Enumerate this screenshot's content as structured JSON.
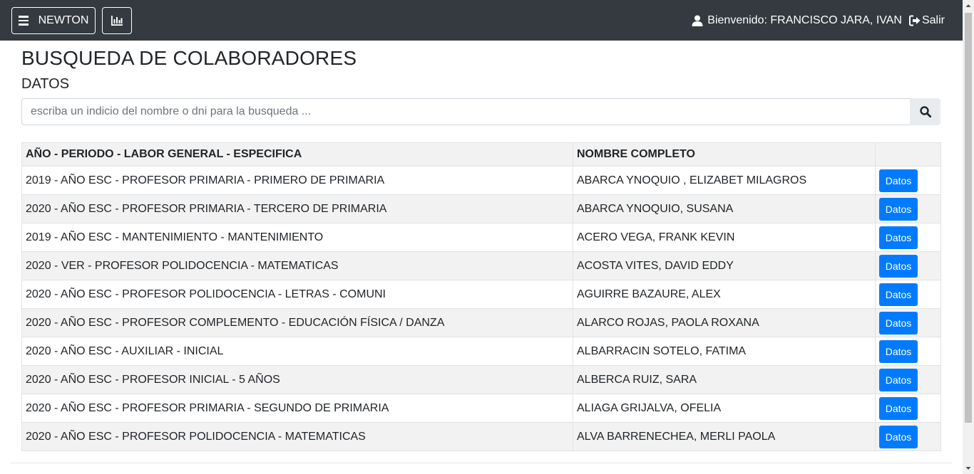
{
  "navbar": {
    "brand_label": "NEWTON",
    "menu_icon": "hamburger-icon",
    "chart_icon": "bar-chart-icon",
    "welcome_text": "Bienvenido: FRANCISCO JARA, IVAN",
    "user_icon": "user-icon",
    "logout_label": "Salir",
    "logout_icon": "sign-out-icon",
    "background_color": "#343a40"
  },
  "page": {
    "title": "BUSQUEDA DE COLABORADORES",
    "section_title": "DATOS"
  },
  "search": {
    "value": "",
    "placeholder": "escriba un indicio del nombre o dni para la busqueda ...",
    "button_icon": "search-icon"
  },
  "table": {
    "headers": [
      "AÑO - PERIODO - LABOR GENERAL - ESPECIFICA",
      "NOMBRE COMPLETO",
      ""
    ],
    "button_color": "#007bff",
    "rows": [
      {
        "labor": "2019 - AÑO ESC - PROFESOR PRIMARIA - PRIMERO DE PRIMARIA",
        "name": "ABARCA YNOQUIO , ELIZABET MILAGROS",
        "action": "Datos"
      },
      {
        "labor": "2020 - AÑO ESC - PROFESOR PRIMARIA - TERCERO DE PRIMARIA",
        "name": "ABARCA YNOQUIO, SUSANA",
        "action": "Datos"
      },
      {
        "labor": "2019 - AÑO ESC - MANTENIMIENTO - MANTENIMIENTO",
        "name": "ACERO VEGA, FRANK KEVIN",
        "action": "Datos"
      },
      {
        "labor": "2020 - VER - PROFESOR POLIDOCENCIA - MATEMATICAS",
        "name": "ACOSTA VITES, DAVID EDDY",
        "action": "Datos"
      },
      {
        "labor": "2020 - AÑO ESC - PROFESOR POLIDOCENCIA - LETRAS - COMUNI",
        "name": "AGUIRRE BAZAURE, ALEX",
        "action": "Datos"
      },
      {
        "labor": "2020 - AÑO ESC - PROFESOR COMPLEMENTO - EDUCACIÓN FÍSICA / DANZA",
        "name": "ALARCO ROJAS, PAOLA ROXANA",
        "action": "Datos"
      },
      {
        "labor": "2020 - AÑO ESC - AUXILIAR - INICIAL",
        "name": "ALBARRACIN SOTELO, FATIMA",
        "action": "Datos"
      },
      {
        "labor": "2020 - AÑO ESC - PROFESOR INICIAL - 5 AÑOS",
        "name": "ALBERCA RUIZ, SARA",
        "action": "Datos"
      },
      {
        "labor": "2020 - AÑO ESC - PROFESOR PRIMARIA - SEGUNDO  DE PRIMARIA",
        "name": "ALIAGA GRIJALVA, OFELIA",
        "action": "Datos"
      },
      {
        "labor": "2020 - AÑO ESC - PROFESOR POLIDOCENCIA - MATEMATICAS",
        "name": "ALVA BARRENECHEA, MERLI PAOLA",
        "action": "Datos"
      }
    ]
  }
}
